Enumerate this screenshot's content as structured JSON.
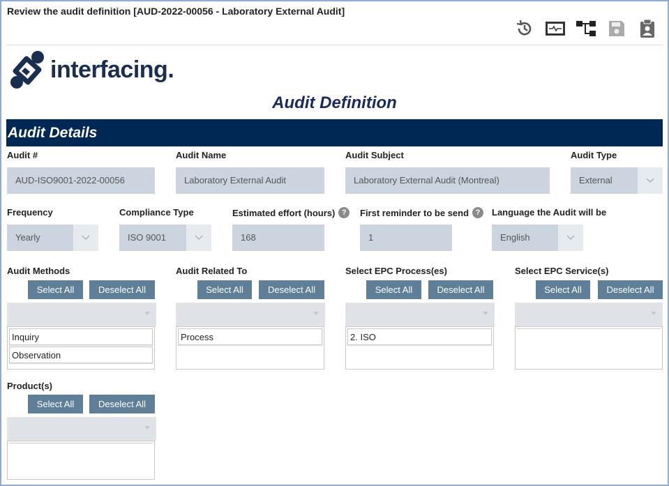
{
  "window": {
    "title": "Review the audit definition [AUD-2022-00056 - Laboratory External Audit]"
  },
  "toolbar": {
    "icons": [
      "history-icon",
      "monitor-activity-icon",
      "workflow-icon",
      "save-icon",
      "clipboard-user-icon"
    ]
  },
  "logo": {
    "text": "interfacing",
    "dot": "."
  },
  "page_title": "Audit Definition",
  "section": {
    "title": "Audit Details"
  },
  "fields": {
    "audit_no": {
      "label": "Audit #",
      "value": "AUD-ISO9001-2022-00056"
    },
    "audit_name": {
      "label": "Audit Name",
      "value": "Laboratory External Audit"
    },
    "audit_subject": {
      "label": "Audit Subject",
      "value": "Laboratory External Audit (Montreal)"
    },
    "audit_type": {
      "label": "Audit Type",
      "value": "External"
    },
    "frequency": {
      "label": "Frequency",
      "value": "Yearly"
    },
    "compliance_type": {
      "label": "Compliance Type",
      "value": "ISO 9001"
    },
    "effort": {
      "label": "Estimated effort (hours)",
      "value": "168",
      "help": "?"
    },
    "reminder": {
      "label": "First reminder to be send",
      "value": "1",
      "help": "?"
    },
    "language": {
      "label": "Language the Audit will be",
      "value": "English"
    }
  },
  "buttons": {
    "select_all": "Select All",
    "deselect_all": "Deselect All"
  },
  "multiselects": {
    "methods": {
      "label": "Audit Methods",
      "items": [
        "Inquiry",
        "Observation"
      ]
    },
    "related": {
      "label": "Audit Related To",
      "items": [
        "Process"
      ]
    },
    "processes": {
      "label": "Select EPC Process(es)",
      "items": [
        "2. ISO"
      ]
    },
    "services": {
      "label": "Select EPC Service(s)",
      "items": []
    },
    "products": {
      "label": "Product(s)",
      "items": []
    }
  }
}
